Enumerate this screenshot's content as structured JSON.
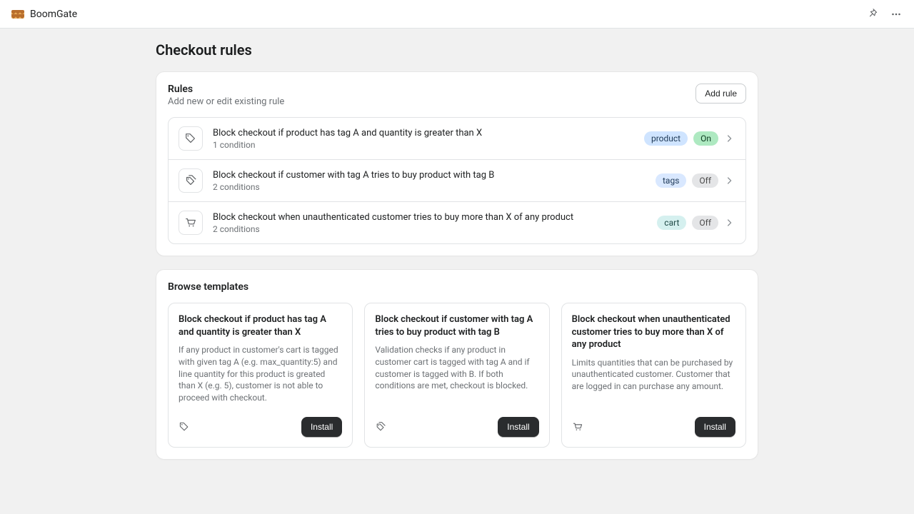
{
  "app": {
    "name": "BoomGate"
  },
  "page": {
    "title": "Checkout rules"
  },
  "rules_card": {
    "title": "Rules",
    "subtitle": "Add new or edit existing rule",
    "add_button": "Add rule"
  },
  "rules": [
    {
      "title": "Block checkout if product has tag A and quantity is greater than X",
      "subtitle": "1 condition",
      "tag": "product",
      "status": "On",
      "status_style": "green",
      "tag_style": "blue",
      "icon": "tag"
    },
    {
      "title": "Block checkout if customer with tag A tries to buy product with tag B",
      "subtitle": "2 conditions",
      "tag": "tags",
      "status": "Off",
      "status_style": "grey",
      "tag_style": "lilac",
      "icon": "tags"
    },
    {
      "title": "Block checkout when unauthenticated customer tries to buy more than X of any product",
      "subtitle": "2 conditions",
      "tag": "cart",
      "status": "Off",
      "status_style": "grey",
      "tag_style": "teal",
      "icon": "cart"
    }
  ],
  "templates": {
    "title": "Browse templates",
    "install_label": "Install",
    "items": [
      {
        "title": "Block checkout if product has tag A and quantity is greater than X",
        "desc": "If any product in customer's cart is tagged with given tag A (e.g. max_quantity:5) and line quantity for this product is greated than X (e.g. 5), customer is not able to proceed with checkout.",
        "icon": "tag"
      },
      {
        "title": "Block checkout if customer with tag A tries to buy product with tag B",
        "desc": "Validation checks if any product in customer cart is tagged with tag A and if customer is tagged with B. If both conditions are met, checkout is blocked.",
        "icon": "tags"
      },
      {
        "title": "Block checkout when unauthenticated customer tries to buy more than X of any product",
        "desc": "Limits quantities that can be purchased by unauthenticated customer. Customer that are logged in can purchase any amount.",
        "icon": "cart"
      }
    ]
  }
}
